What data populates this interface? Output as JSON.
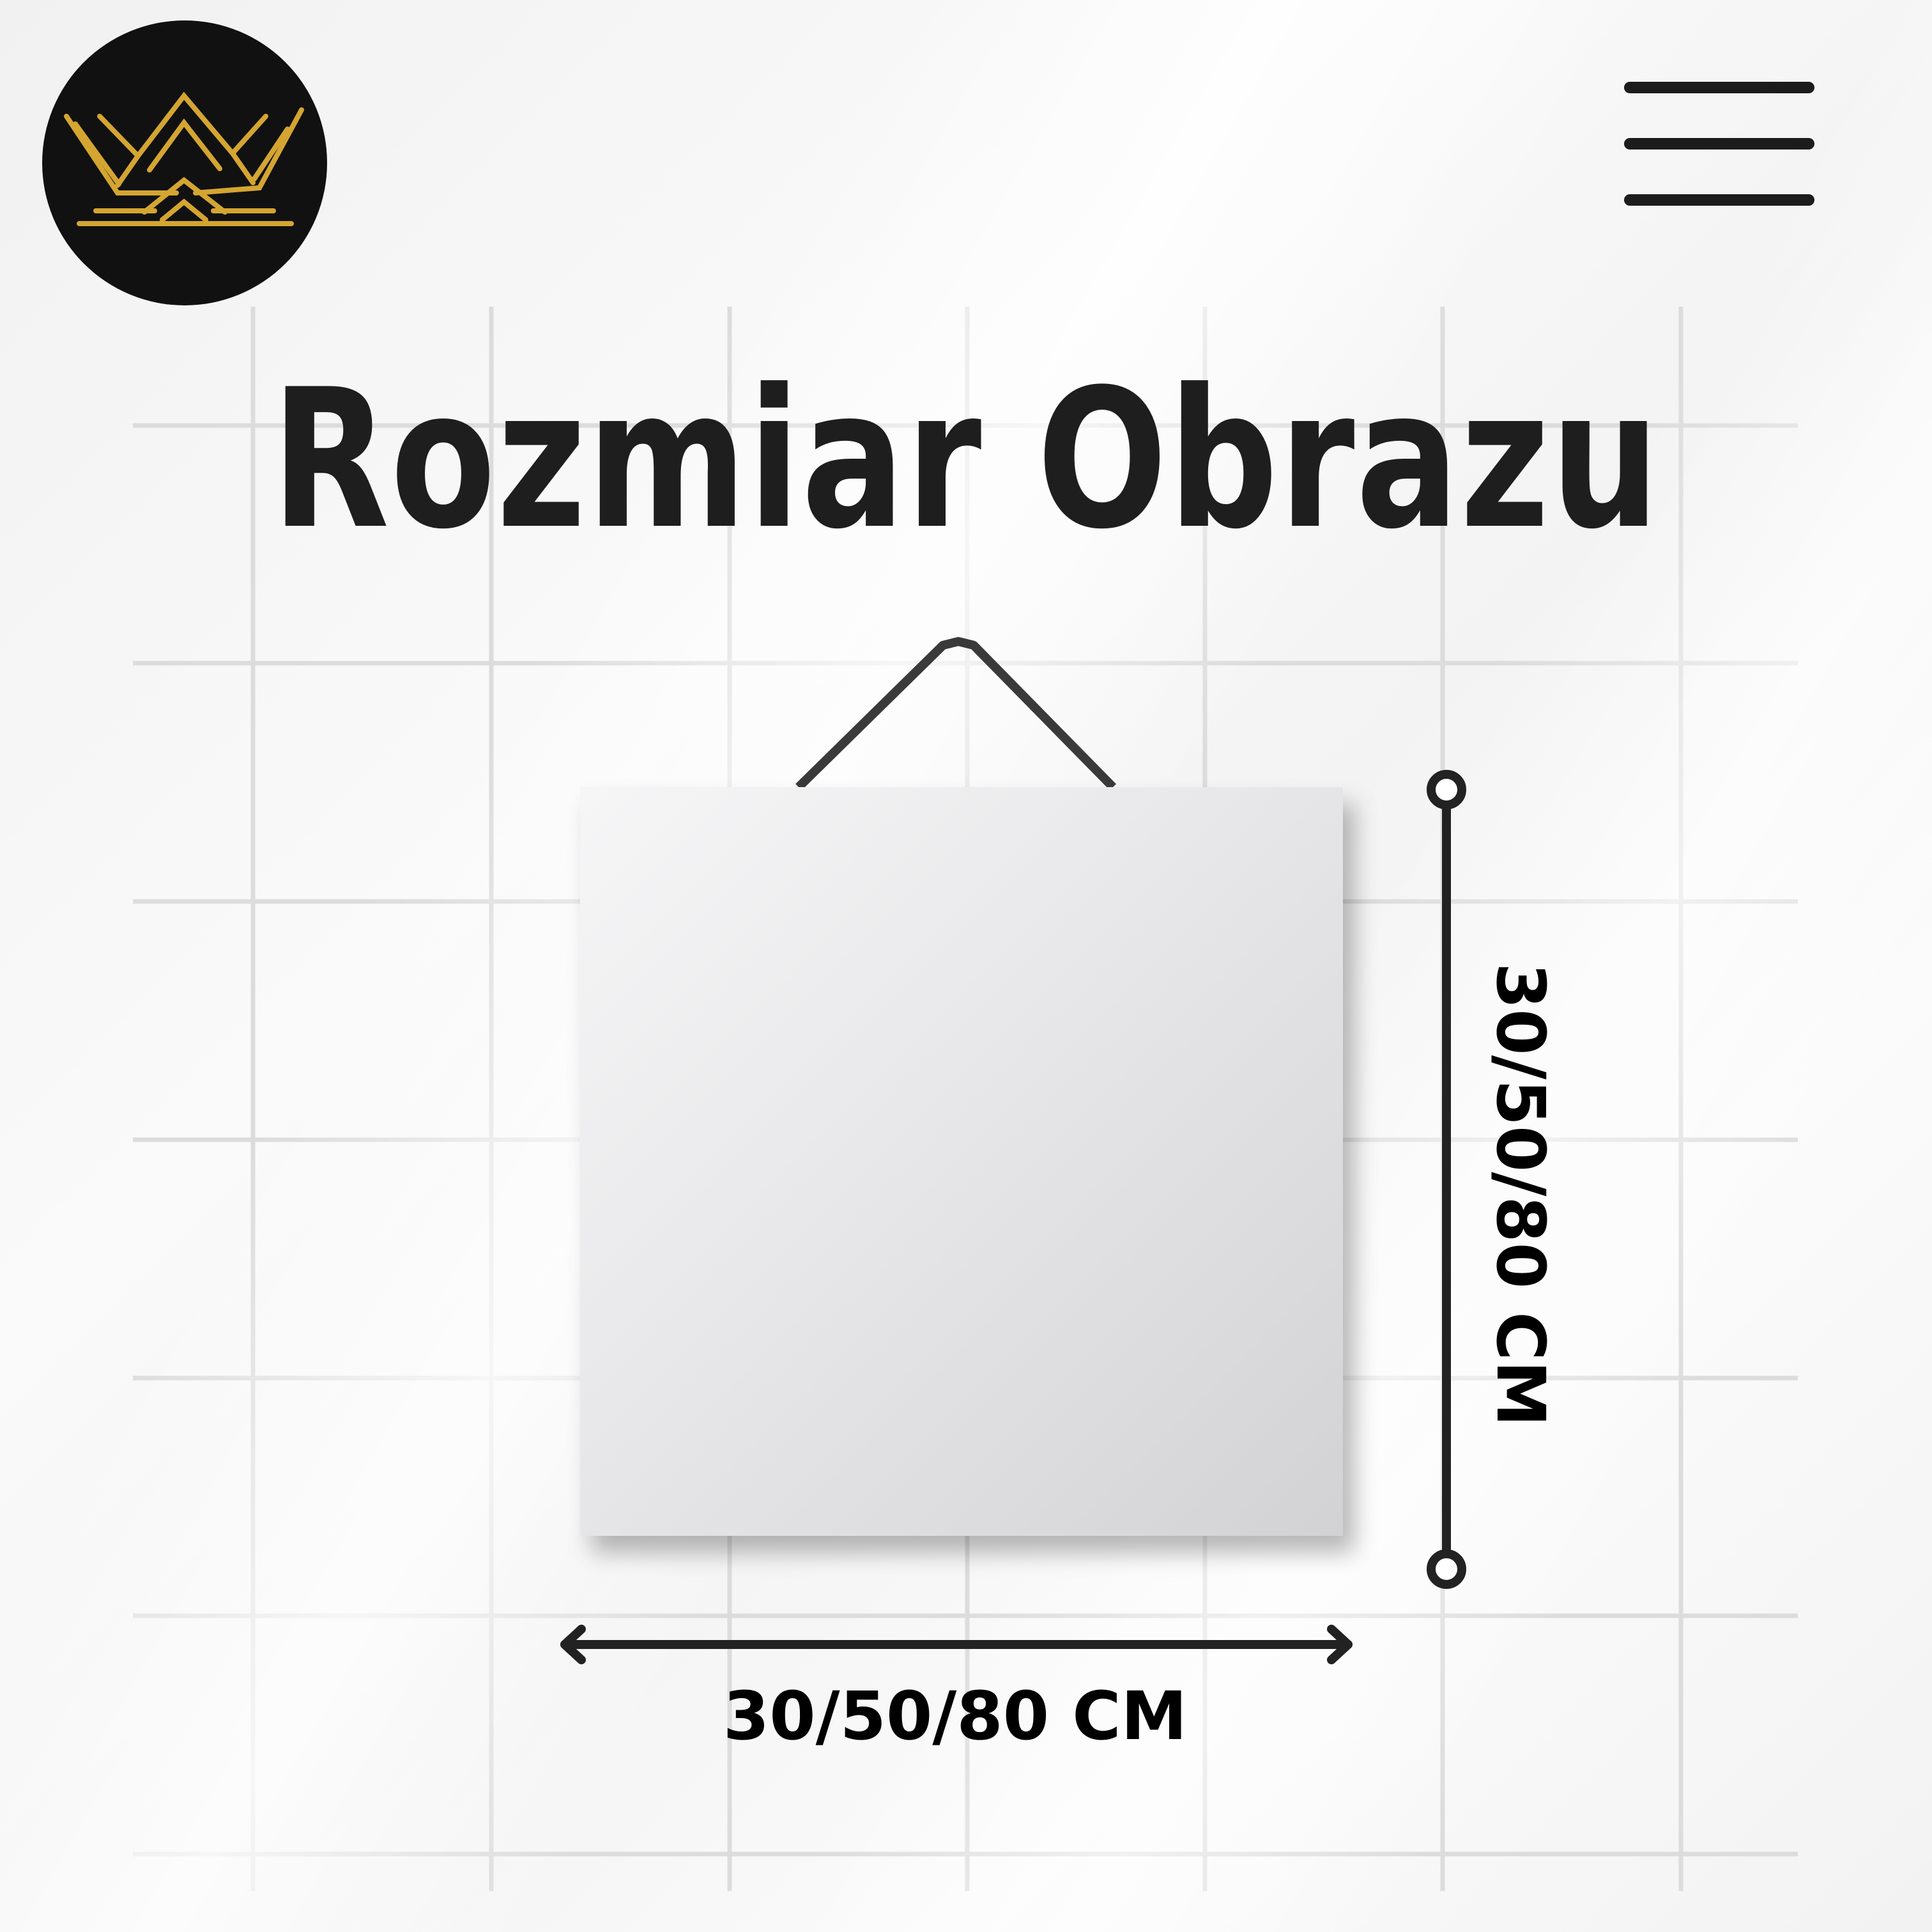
{
  "header": {
    "logo": {
      "icon": "crown-icon",
      "background_color": "#111111",
      "accent_color": "#d4a531"
    },
    "menu": {
      "icon": "hamburger-menu-icon"
    }
  },
  "main": {
    "title": "Rozmiar Obrazu",
    "width_label": "30/50/80 CM",
    "height_label": "30/50/80 CM"
  },
  "colors": {
    "text": "#1e1e1e",
    "dimension_lines": "#222222",
    "grid": "#dedede"
  }
}
